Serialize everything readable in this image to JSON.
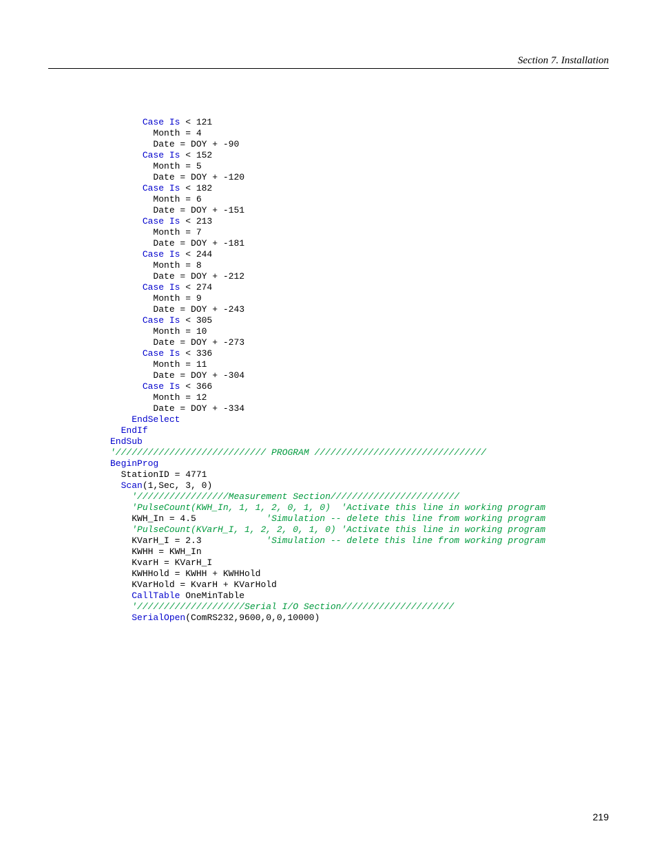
{
  "header": {
    "title": "Section 7.  Installation"
  },
  "page_number": "219",
  "code": {
    "lines": [
      {
        "i": 3,
        "seg": [
          {
            "t": "kw",
            "v": "Case Is"
          },
          {
            "t": "pl",
            "v": " < 121"
          }
        ]
      },
      {
        "i": 4,
        "seg": [
          {
            "t": "pl",
            "v": "Month = 4"
          }
        ]
      },
      {
        "i": 4,
        "seg": [
          {
            "t": "pl",
            "v": "Date = DOY + -90"
          }
        ]
      },
      {
        "i": 3,
        "seg": [
          {
            "t": "kw",
            "v": "Case Is"
          },
          {
            "t": "pl",
            "v": " < 152"
          }
        ]
      },
      {
        "i": 4,
        "seg": [
          {
            "t": "pl",
            "v": "Month = 5"
          }
        ]
      },
      {
        "i": 4,
        "seg": [
          {
            "t": "pl",
            "v": "Date = DOY + -120"
          }
        ]
      },
      {
        "i": 3,
        "seg": [
          {
            "t": "kw",
            "v": "Case Is"
          },
          {
            "t": "pl",
            "v": " < 182"
          }
        ]
      },
      {
        "i": 4,
        "seg": [
          {
            "t": "pl",
            "v": "Month = 6"
          }
        ]
      },
      {
        "i": 4,
        "seg": [
          {
            "t": "pl",
            "v": "Date = DOY + -151"
          }
        ]
      },
      {
        "i": 3,
        "seg": [
          {
            "t": "kw",
            "v": "Case Is"
          },
          {
            "t": "pl",
            "v": " < 213"
          }
        ]
      },
      {
        "i": 4,
        "seg": [
          {
            "t": "pl",
            "v": "Month = 7"
          }
        ]
      },
      {
        "i": 4,
        "seg": [
          {
            "t": "pl",
            "v": "Date = DOY + -181"
          }
        ]
      },
      {
        "i": 3,
        "seg": [
          {
            "t": "kw",
            "v": "Case Is"
          },
          {
            "t": "pl",
            "v": " < 244"
          }
        ]
      },
      {
        "i": 4,
        "seg": [
          {
            "t": "pl",
            "v": "Month = 8"
          }
        ]
      },
      {
        "i": 4,
        "seg": [
          {
            "t": "pl",
            "v": "Date = DOY + -212"
          }
        ]
      },
      {
        "i": 3,
        "seg": [
          {
            "t": "kw",
            "v": "Case Is"
          },
          {
            "t": "pl",
            "v": " < 274"
          }
        ]
      },
      {
        "i": 4,
        "seg": [
          {
            "t": "pl",
            "v": "Month = 9"
          }
        ]
      },
      {
        "i": 4,
        "seg": [
          {
            "t": "pl",
            "v": "Date = DOY + -243"
          }
        ]
      },
      {
        "i": 3,
        "seg": [
          {
            "t": "kw",
            "v": "Case Is"
          },
          {
            "t": "pl",
            "v": " < 305"
          }
        ]
      },
      {
        "i": 4,
        "seg": [
          {
            "t": "pl",
            "v": "Month = 10"
          }
        ]
      },
      {
        "i": 4,
        "seg": [
          {
            "t": "pl",
            "v": "Date = DOY + -273"
          }
        ]
      },
      {
        "i": 3,
        "seg": [
          {
            "t": "kw",
            "v": "Case Is"
          },
          {
            "t": "pl",
            "v": " < 336"
          }
        ]
      },
      {
        "i": 4,
        "seg": [
          {
            "t": "pl",
            "v": "Month = 11"
          }
        ]
      },
      {
        "i": 4,
        "seg": [
          {
            "t": "pl",
            "v": "Date = DOY + -304"
          }
        ]
      },
      {
        "i": 3,
        "seg": [
          {
            "t": "kw",
            "v": "Case Is"
          },
          {
            "t": "pl",
            "v": " < 366"
          }
        ]
      },
      {
        "i": 4,
        "seg": [
          {
            "t": "pl",
            "v": "Month = 12"
          }
        ]
      },
      {
        "i": 4,
        "seg": [
          {
            "t": "pl",
            "v": "Date = DOY + -334"
          }
        ]
      },
      {
        "i": 2,
        "seg": [
          {
            "t": "kw",
            "v": "EndSelect"
          }
        ]
      },
      {
        "i": 1,
        "seg": [
          {
            "t": "kw",
            "v": "EndIf"
          }
        ]
      },
      {
        "i": 0,
        "seg": [
          {
            "t": "kw",
            "v": "EndSub"
          }
        ]
      },
      {
        "i": 0,
        "seg": [
          {
            "t": "pl",
            "v": ""
          }
        ]
      },
      {
        "i": 0,
        "seg": [
          {
            "t": "cm",
            "v": "'//////////////////////////// PROGRAM ////////////////////////////////"
          }
        ]
      },
      {
        "i": 0,
        "seg": [
          {
            "t": "kw",
            "v": "BeginProg"
          }
        ]
      },
      {
        "i": 1,
        "seg": [
          {
            "t": "pl",
            "v": "StationID = 4771"
          }
        ]
      },
      {
        "i": 1,
        "seg": [
          {
            "t": "kw",
            "v": "Scan"
          },
          {
            "t": "pl",
            "v": "(1,Sec, 3, 0)"
          }
        ]
      },
      {
        "i": 0,
        "seg": [
          {
            "t": "pl",
            "v": ""
          }
        ]
      },
      {
        "i": 2,
        "seg": [
          {
            "t": "cm",
            "v": "'/////////////////Measurement Section////////////////////////"
          }
        ]
      },
      {
        "i": 2,
        "seg": [
          {
            "t": "cm",
            "v": "'PulseCount(KWH_In, 1, 1, 2, 0, 1, 0)  'Activate this line in working program"
          }
        ]
      },
      {
        "i": 2,
        "seg": [
          {
            "t": "pl",
            "v": "KWH_In = 4.5             "
          },
          {
            "t": "cm",
            "v": "'Simulation -- delete this line from working program"
          }
        ]
      },
      {
        "i": 0,
        "seg": [
          {
            "t": "pl",
            "v": ""
          }
        ]
      },
      {
        "i": 2,
        "seg": [
          {
            "t": "cm",
            "v": "'PulseCount(KVarH_I, 1, 2, 2, 0, 1, 0) 'Activate this line in working program"
          }
        ]
      },
      {
        "i": 2,
        "seg": [
          {
            "t": "pl",
            "v": "KVarH_I = 2.3            "
          },
          {
            "t": "cm",
            "v": "'Simulation -- delete this line from working program"
          }
        ]
      },
      {
        "i": 2,
        "seg": [
          {
            "t": "pl",
            "v": "KWHH = KWH_In"
          }
        ]
      },
      {
        "i": 2,
        "seg": [
          {
            "t": "pl",
            "v": "KvarH = KVarH_I"
          }
        ]
      },
      {
        "i": 2,
        "seg": [
          {
            "t": "pl",
            "v": "KWHHold = KWHH + KWHHold"
          }
        ]
      },
      {
        "i": 2,
        "seg": [
          {
            "t": "pl",
            "v": "KVarHold = KvarH + KVarHold"
          }
        ]
      },
      {
        "i": 0,
        "seg": [
          {
            "t": "pl",
            "v": ""
          }
        ]
      },
      {
        "i": 2,
        "seg": [
          {
            "t": "kw",
            "v": "CallTable"
          },
          {
            "t": "pl",
            "v": " OneMinTable"
          }
        ]
      },
      {
        "i": 0,
        "seg": [
          {
            "t": "pl",
            "v": ""
          }
        ]
      },
      {
        "i": 2,
        "seg": [
          {
            "t": "cm",
            "v": "'////////////////////Serial I/O Section/////////////////////"
          }
        ]
      },
      {
        "i": 2,
        "seg": [
          {
            "t": "kw",
            "v": "SerialOpen"
          },
          {
            "t": "pl",
            "v": "(ComRS232,9600,0,0,10000)"
          }
        ]
      }
    ]
  }
}
